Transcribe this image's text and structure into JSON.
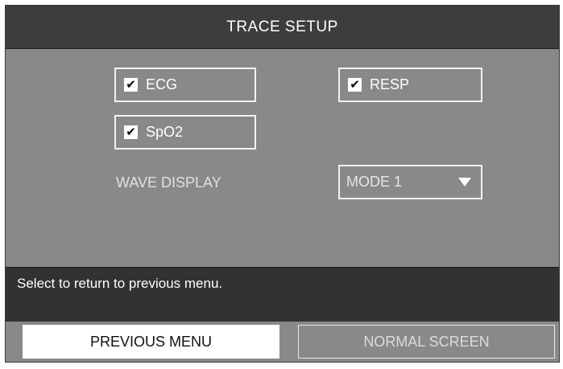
{
  "title": "TRACE SETUP",
  "checkboxes": {
    "ecg": {
      "label": "ECG",
      "checked": true,
      "mark": "✔"
    },
    "resp": {
      "label": "RESP",
      "checked": true,
      "mark": "✔"
    },
    "spo2": {
      "label": "SpO2",
      "checked": true,
      "mark": "✔"
    }
  },
  "wave_display": {
    "label": "WAVE DISPLAY",
    "value": "MODE 1",
    "icon": "triangle-down-icon"
  },
  "help_text": "Select to return to previous menu.",
  "buttons": {
    "previous": "PREVIOUS MENU",
    "normal": "NORMAL SCREEN"
  },
  "colors": {
    "panel": "#898989",
    "title_bar": "#3d3d3d",
    "help_panel": "#323232",
    "highlight": "#ffffff"
  }
}
